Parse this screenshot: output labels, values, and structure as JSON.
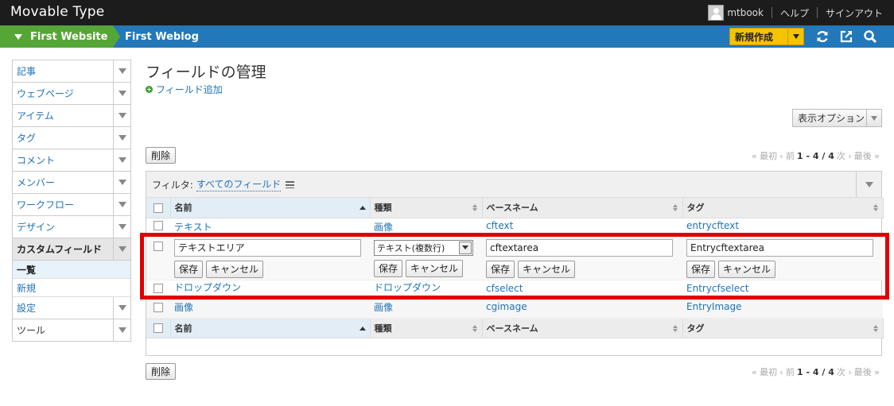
{
  "app": {
    "brand": "Movable Type"
  },
  "header": {
    "user_name": "mtbook",
    "help": "ヘルプ",
    "signout": "サインアウト"
  },
  "nav": {
    "website": "First Website",
    "blog": "First Weblog",
    "new_button": "新規作成"
  },
  "sidebar": {
    "items": [
      {
        "label": "記事"
      },
      {
        "label": "ウェブページ"
      },
      {
        "label": "アイテム"
      },
      {
        "label": "タグ"
      },
      {
        "label": "コメント"
      },
      {
        "label": "メンバー"
      },
      {
        "label": "ワークフロー"
      },
      {
        "label": "デザイン"
      },
      {
        "label": "カスタムフィールド"
      }
    ],
    "sub_items": [
      {
        "label": "一覧"
      },
      {
        "label": "新規"
      }
    ],
    "bottom_items": [
      {
        "label": "設定"
      },
      {
        "label": "ツール"
      }
    ]
  },
  "main": {
    "title": "フィールドの管理",
    "add_link": "フィールド追加",
    "display_options": "表示オプション",
    "delete_button": "削除",
    "pager": {
      "first": "« 最初",
      "prev": "‹ 前",
      "range": "1 - 4 / 4",
      "next": "次 ›",
      "last": "最後 »"
    },
    "filter": {
      "label": "フィルタ:",
      "value": "すべてのフィールド"
    },
    "columns": [
      "名前",
      "種類",
      "ベースネーム",
      "タグ"
    ],
    "rows": [
      {
        "name": "テキスト",
        "type": "画像",
        "basename": "cftext",
        "tag": "entrycftext"
      },
      {
        "name": "ドロップダウン",
        "type": "ドロップダウン",
        "basename": "cfselect",
        "tag": "Entrycfselect"
      },
      {
        "name": "画像",
        "type": "画像",
        "basename": "cgimage",
        "tag": "EntryImage"
      }
    ],
    "edit_row": {
      "name_value": "テキストエリア",
      "type_value": "テキスト(複数行)",
      "basename_value": "cftextarea",
      "tag_value": "Entrycftextarea",
      "save": "保存",
      "cancel": "キャンセル"
    }
  },
  "colors": {
    "topbar": "#1c1c1c",
    "navbar": "#2278b8",
    "website_tab": "#56a537",
    "new_button": "#f5c400",
    "link": "#1f73b7",
    "highlight": "#e00000"
  }
}
